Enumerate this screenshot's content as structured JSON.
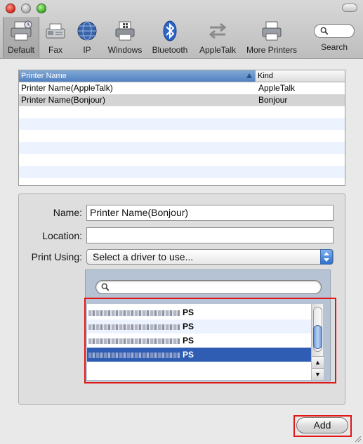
{
  "toolbar": {
    "items": [
      {
        "label": "Default",
        "icon": "printer-default-icon",
        "selected": true
      },
      {
        "label": "Fax",
        "icon": "fax-icon"
      },
      {
        "label": "IP",
        "icon": "globe-icon"
      },
      {
        "label": "Windows",
        "icon": "windows-printer-icon"
      },
      {
        "label": "Bluetooth",
        "icon": "bluetooth-icon"
      },
      {
        "label": "AppleTalk",
        "icon": "appletalk-arrows-icon"
      },
      {
        "label": "More Printers",
        "icon": "printer-icon"
      },
      {
        "label": "Search",
        "icon": "search-icon"
      }
    ]
  },
  "printer_list": {
    "columns": [
      "Printer Name",
      "Kind"
    ],
    "rows": [
      {
        "name": "Printer Name(AppleTalk)",
        "kind": "AppleTalk"
      },
      {
        "name": "Printer Name(Bonjour)",
        "kind": "Bonjour",
        "selected": true
      }
    ]
  },
  "details": {
    "name_label": "Name:",
    "name_value": "Printer Name(Bonjour)",
    "location_label": "Location:",
    "location_value": "",
    "print_using_label": "Print Using:",
    "print_using_value": "Select a driver to use...",
    "driver_search_placeholder": "",
    "drivers": [
      {
        "suffix": "PS"
      },
      {
        "suffix": "PS"
      },
      {
        "suffix": "PS"
      },
      {
        "suffix": "PS",
        "selected": true
      }
    ]
  },
  "buttons": {
    "add": "Add"
  },
  "colors": {
    "selection_blue": "#2f5db4",
    "highlight_red": "#e11717",
    "header_blue": "#4f82c2"
  }
}
